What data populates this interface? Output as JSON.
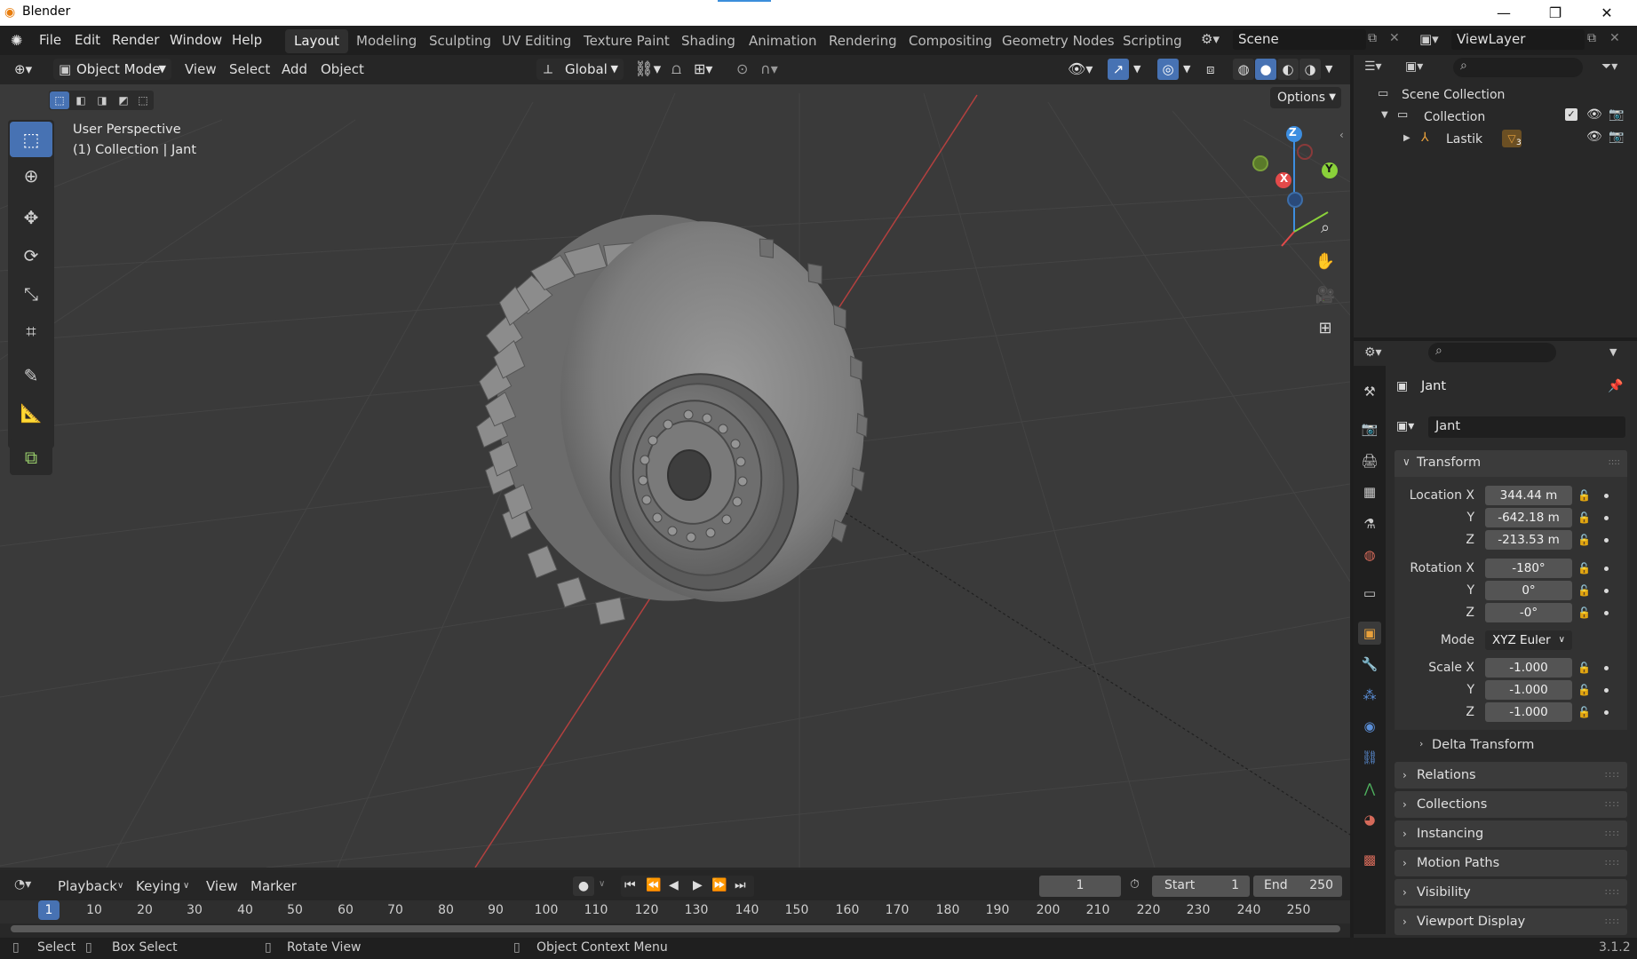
{
  "titlebar": {
    "title": "Blender",
    "minimize": "—",
    "restore": "❐",
    "close": "✕"
  },
  "menu": {
    "file": "File",
    "edit": "Edit",
    "render": "Render",
    "window": "Window",
    "help": "Help"
  },
  "workspaces": [
    "Layout",
    "Modeling",
    "Sculpting",
    "UV Editing",
    "Texture Paint",
    "Shading",
    "Animation",
    "Rendering",
    "Compositing",
    "Geometry Nodes",
    "Scripting"
  ],
  "active_workspace": "Layout",
  "scene": {
    "name": "Scene"
  },
  "view_layer": {
    "name": "ViewLayer"
  },
  "viewport_header": {
    "mode": "Object Mode",
    "view": "View",
    "select": "Select",
    "add": "Add",
    "object": "Object",
    "orientation": "Global",
    "options": "Options"
  },
  "viewport": {
    "perspective": "User Perspective",
    "collection_info": "(1) Collection | Jant",
    "axis_x": "X",
    "axis_y": "Y",
    "axis_z": "Z"
  },
  "outliner": {
    "scene_collection": "Scene Collection",
    "collection": "Collection",
    "object": "Lastik",
    "object_badge": "3"
  },
  "properties": {
    "object_name": "Jant",
    "data_name": "Jant",
    "transform_label": "Transform",
    "location_x_label": "Location X",
    "y_label": "Y",
    "z_label": "Z",
    "rotation_x_label": "Rotation X",
    "scale_x_label": "Scale X",
    "mode_label": "Mode",
    "location": {
      "x": "344.44 m",
      "y": "-642.18 m",
      "z": "-213.53 m"
    },
    "rotation": {
      "x": "-180°",
      "y": "0°",
      "z": "-0°"
    },
    "rotation_mode": "XYZ Euler",
    "scale": {
      "x": "-1.000",
      "y": "-1.000",
      "z": "-1.000"
    },
    "panels": [
      "Delta Transform",
      "Relations",
      "Collections",
      "Instancing",
      "Motion Paths",
      "Visibility",
      "Viewport Display"
    ]
  },
  "timeline": {
    "playback": "Playback",
    "keying": "Keying",
    "view": "View",
    "marker": "Marker",
    "current_frame": "1",
    "start_label": "Start",
    "start": "1",
    "end_label": "End",
    "end": "250",
    "ticks": [
      "1",
      "10",
      "20",
      "30",
      "40",
      "50",
      "60",
      "70",
      "80",
      "90",
      "100",
      "110",
      "120",
      "130",
      "140",
      "150",
      "160",
      "170",
      "180",
      "190",
      "200",
      "210",
      "220",
      "230",
      "240",
      "250"
    ]
  },
  "statusbar": {
    "select": "Select",
    "box_select": "Box Select",
    "rotate_view": "Rotate View",
    "context_menu": "Object Context Menu",
    "version": "3.1.2"
  },
  "colors": {
    "accent": "#4772b3",
    "x_axis": "#e34a4a",
    "y_axis": "#8ad13a",
    "z_axis": "#3d8ee0",
    "object_orange": "#e8a13c"
  }
}
